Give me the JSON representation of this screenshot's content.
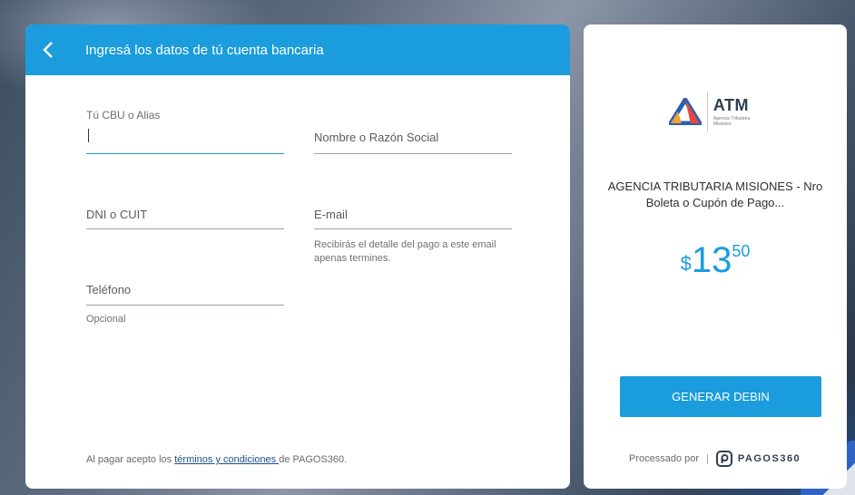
{
  "form": {
    "title": "Ingresá los datos de tú cuenta bancaria",
    "cbu": {
      "label": "Tú CBU o Alias",
      "value": ""
    },
    "name": {
      "placeholder": "Nombre o Razón Social"
    },
    "dni": {
      "placeholder": "DNI o CUIT"
    },
    "email": {
      "placeholder": "E-mail",
      "hint": "Recibirás el detalle del pago a este email apenas termines."
    },
    "phone": {
      "placeholder": "Teléfono",
      "hint": "Opcional"
    },
    "terms": {
      "prefix": "Al pagar acepto los ",
      "link": "términos y condiciones ",
      "suffix": "de PAGOS360."
    }
  },
  "payment": {
    "logo": {
      "name": "ATM",
      "subtitle": "Agencia Tributaria Misiones"
    },
    "merchant": "AGENCIA TRIBUTARIA MISIONES - Nro Boleta o Cupón de Pago...",
    "amount": {
      "currency": "$",
      "integer": "13",
      "decimal": "50"
    },
    "button": "GENERAR DEBIN",
    "processed_by": "Processado por",
    "separator": "|",
    "provider": "PAGOS360"
  },
  "colors": {
    "accent": "#1b9cdc",
    "brand_dark": "#2d3e55"
  }
}
